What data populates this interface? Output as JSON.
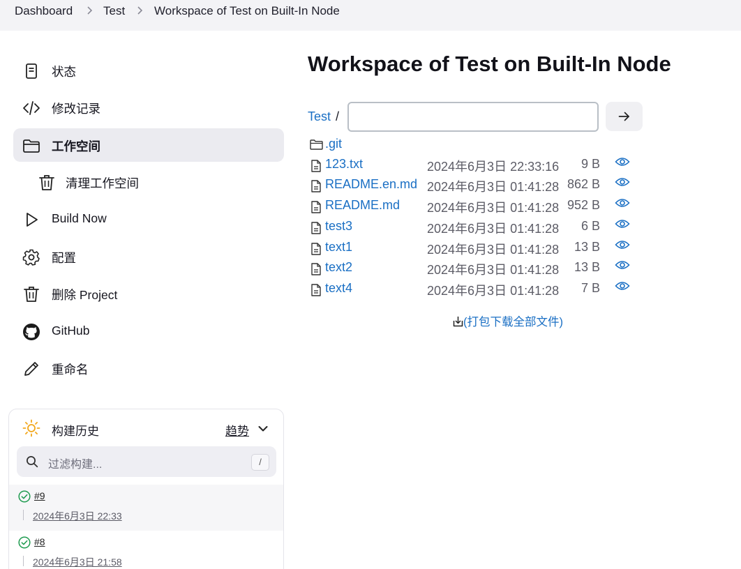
{
  "breadcrumb": {
    "items": [
      "Dashboard",
      "Test",
      "Workspace of Test on Built-In Node"
    ]
  },
  "sidebar": {
    "items": [
      {
        "label": "状态",
        "icon": "status-document-icon"
      },
      {
        "label": "修改记录",
        "icon": "code-icon"
      },
      {
        "label": "工作空间",
        "icon": "folder-icon",
        "active": true
      },
      {
        "label": "清理工作空间",
        "icon": "trash-icon",
        "sub": true
      },
      {
        "label": "Build Now",
        "icon": "play-icon"
      },
      {
        "label": "配置",
        "icon": "gear-icon"
      },
      {
        "label": "删除 Project",
        "icon": "trash-icon"
      },
      {
        "label": "GitHub",
        "icon": "github-icon"
      },
      {
        "label": "重命名",
        "icon": "pencil-icon"
      }
    ]
  },
  "build_history": {
    "title": "构建历史",
    "trend_label": "趋势",
    "filter_placeholder": "过滤构建...",
    "shortcut_key": "/",
    "builds": [
      {
        "number": "#9",
        "date": "2024年6月3日 22:33",
        "status": "success"
      },
      {
        "number": "#8",
        "date": "2024年6月3日 21:58",
        "status": "success"
      }
    ]
  },
  "main": {
    "title": "Workspace of Test on Built-In Node",
    "path_root": "Test",
    "path_separator": "/",
    "path_input_value": "",
    "files": [
      {
        "name": ".git",
        "type": "folder",
        "date": "",
        "size": ""
      },
      {
        "name": "123.txt",
        "type": "file",
        "date": "2024年6月3日 22:33:16",
        "size": "9 B"
      },
      {
        "name": "README.en.md",
        "type": "file",
        "date": "2024年6月3日 01:41:28",
        "size": "862 B"
      },
      {
        "name": "README.md",
        "type": "file",
        "date": "2024年6月3日 01:41:28",
        "size": "952 B"
      },
      {
        "name": "test3",
        "type": "file",
        "date": "2024年6月3日 01:41:28",
        "size": "6 B"
      },
      {
        "name": "text1",
        "type": "file",
        "date": "2024年6月3日 01:41:28",
        "size": "13 B"
      },
      {
        "name": "text2",
        "type": "file",
        "date": "2024年6月3日 01:41:28",
        "size": "13 B"
      },
      {
        "name": "text4",
        "type": "file",
        "date": "2024年6月3日 01:41:28",
        "size": "7 B"
      }
    ],
    "download_all_label": "(打包下载全部文件)"
  },
  "colors": {
    "link": "#1a6fc4",
    "success": "#1e9b4f",
    "sun": "#f2a71b",
    "active_bg": "#ebebf0"
  }
}
